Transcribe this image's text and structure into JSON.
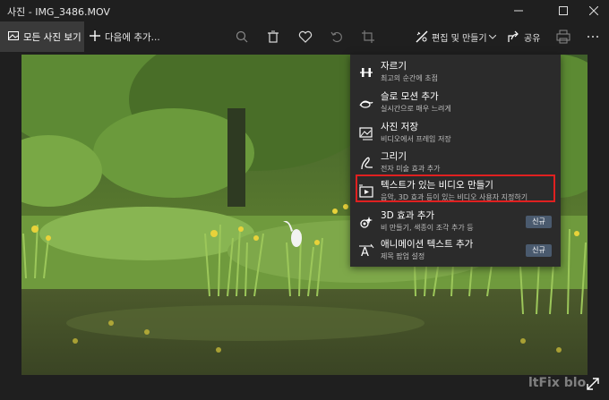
{
  "window": {
    "title": "사진 - IMG_3486.MOV",
    "controls": [
      "minimize-icon",
      "maximize-icon",
      "close-icon"
    ]
  },
  "toolbar": {
    "all_photos_label": "모든 사진 보기",
    "add_to_label": "다음에 추가...",
    "icons": [
      "zoom-icon",
      "delete-icon",
      "favorite-icon",
      "rotate-icon",
      "crop-icon"
    ],
    "edit_create_label": "편집 및 만들기",
    "share_label": "공유",
    "right_icons": [
      "print-icon",
      "more-icon"
    ]
  },
  "menu": {
    "items": [
      {
        "title": "자르기",
        "desc": "최고의 순간에 초점",
        "icon": "trim-icon"
      },
      {
        "title": "슬로 모션 추가",
        "desc": "실시간으로 매우 느려게",
        "icon": "slow-motion-icon"
      },
      {
        "title": "사진 저장",
        "desc": "비디오에서 프레임 저장",
        "icon": "save-photo-icon"
      },
      {
        "title": "그리기",
        "desc": "전자 미술 효과 추가",
        "icon": "draw-icon"
      },
      {
        "title": "텍스트가 있는 비디오 만들기",
        "desc": "음악, 3D 효과 등이 있는 비디오 사용자 지정하기",
        "icon": "video-text-icon",
        "highlighted": true
      },
      {
        "title": "3D 효과 추가",
        "desc": "비 만들기, 색종이 조각 추가 등",
        "icon": "3d-effects-icon",
        "badge": "신규"
      },
      {
        "title": "애니메이션 텍스트 추가",
        "desc": "제목 팝업 설정",
        "icon": "animated-text-icon",
        "badge": "신규"
      }
    ]
  },
  "watermark": "ltFix blo",
  "colors": {
    "highlight": "#e02020",
    "badge": "#4a5a6e",
    "menu_bg": "#2b2b2b"
  }
}
